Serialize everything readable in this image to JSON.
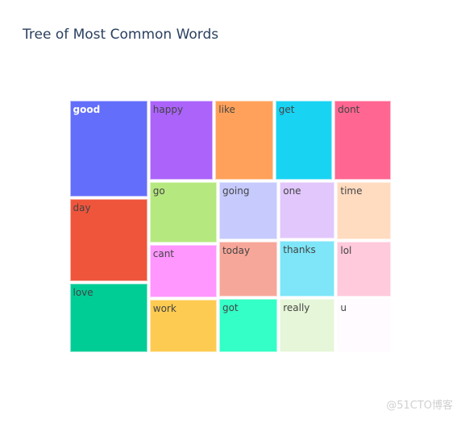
{
  "chart_data": {
    "type": "treemap",
    "title": "Tree of Most Common Words",
    "items": [
      {
        "label": "good",
        "value": 11520,
        "color": "#636efa",
        "text_color": "#ffffff"
      },
      {
        "label": "day",
        "value": 9792,
        "color": "#ef553b",
        "text_color": "#444444"
      },
      {
        "label": "love",
        "value": 8352,
        "color": "#00cc96",
        "text_color": "#444444"
      },
      {
        "label": "happy",
        "value": 7840,
        "color": "#ab63fa",
        "text_color": "#444444"
      },
      {
        "label": "like",
        "value": 7154,
        "color": "#ffa15a",
        "text_color": "#444444"
      },
      {
        "label": "get",
        "value": 7056,
        "color": "#19d3f3",
        "text_color": "#444444"
      },
      {
        "label": "dont",
        "value": 7056,
        "color": "#ff6692",
        "text_color": "#444444"
      },
      {
        "label": "go",
        "value": 6384,
        "color": "#b6e880",
        "text_color": "#444444"
      },
      {
        "label": "cant",
        "value": 5544,
        "color": "#ff97ff",
        "text_color": "#444444"
      },
      {
        "label": "work",
        "value": 5544,
        "color": "#fecb52",
        "text_color": "#444444"
      },
      {
        "label": "going",
        "value": 5256,
        "color": "#c6cafd",
        "text_color": "#444444"
      },
      {
        "label": "today",
        "value": 5037,
        "color": "#f7a799",
        "text_color": "#444444"
      },
      {
        "label": "got",
        "value": 4964,
        "color": "#33ffc6",
        "text_color": "#444444"
      },
      {
        "label": "one",
        "value": 4899,
        "color": "#e1c7fc",
        "text_color": "#444444"
      },
      {
        "label": "thanks",
        "value": 4830,
        "color": "#7ee6f8",
        "text_color": "#444444"
      },
      {
        "label": "really",
        "value": 4692,
        "color": "#e6f6d8",
        "text_color": "#444444"
      },
      {
        "label": "time",
        "value": 4896,
        "color": "#ffdbc0",
        "text_color": "#444444"
      },
      {
        "label": "lol",
        "value": 4692,
        "color": "#ffcadb",
        "text_color": "#444444"
      },
      {
        "label": "u",
        "value": 4624,
        "color": "#fffbfe",
        "text_color": "#444444"
      }
    ]
  },
  "watermark": "@51CTO博客"
}
